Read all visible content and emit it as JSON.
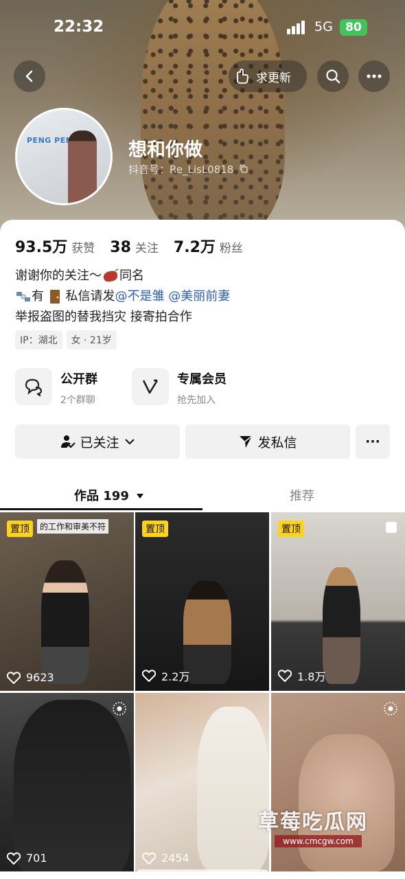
{
  "status": {
    "time": "22:32",
    "network": "5G",
    "battery": "80"
  },
  "header": {
    "request_update": "求更新"
  },
  "profile": {
    "avatar_brand": "PENG PENG",
    "name": "想和你做",
    "handle": "抖音号：Re_LisL0818"
  },
  "stats": [
    {
      "value": "93.5万",
      "label": "获赞"
    },
    {
      "value": "38",
      "label": "关注"
    },
    {
      "value": "7.2万",
      "label": "粉丝"
    }
  ],
  "bio": {
    "line1_text": "谢谢你的关注～",
    "line1_suffix": "同名",
    "line2_prefix": "有",
    "line2_text": "私信请发",
    "mention1": "@不是雏",
    "mention2": "@美丽前妻",
    "line3": "举报盗图的替我挡灾  接寄拍合作"
  },
  "tags": [
    "IP：湖北",
    "女 · 21岁"
  ],
  "features": [
    {
      "title": "公开群",
      "subtitle": "2个群聊",
      "icon": "chat-bubbles-icon"
    },
    {
      "title": "专属会员",
      "subtitle": "抢先加入",
      "icon": "v-badge-icon"
    }
  ],
  "actions": {
    "followed": "已关注",
    "message": "发私信",
    "more": "···"
  },
  "tabs": {
    "works": "作品 199",
    "recommend": "推荐"
  },
  "posts": [
    {
      "pinned": "置顶",
      "caption": "的工作和审美不符",
      "likes": "9623"
    },
    {
      "pinned": "置顶",
      "likes": "2.2万"
    },
    {
      "pinned": "置顶",
      "likes": "1.8万"
    },
    {
      "likes": "701"
    },
    {
      "likes": "2454"
    },
    {
      "likes": ""
    }
  ],
  "watermark": {
    "text": "草莓吃瓜网",
    "url": "www.cmcgw.com"
  },
  "colors": {
    "accent_yellow": "#ffd21d",
    "mention_blue": "#2b5fb3",
    "battery_green": "#41c45b"
  }
}
